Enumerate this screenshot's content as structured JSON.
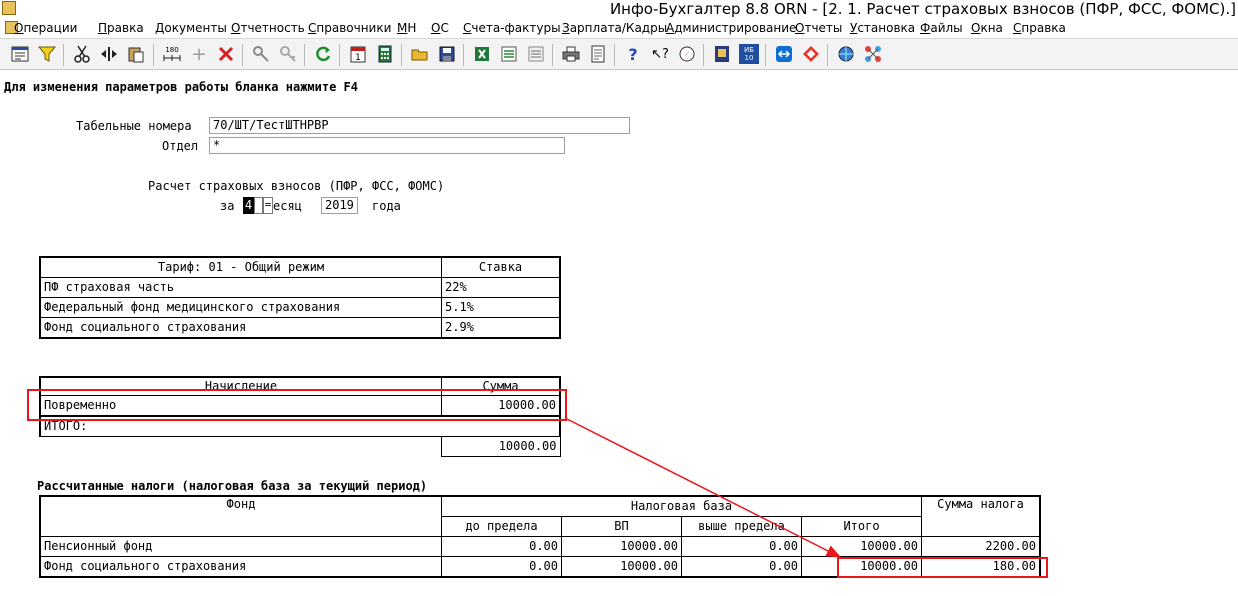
{
  "titlebar": {
    "title": "Инфо-Бухгалтер 8.8   ORN   - [2. 1. Расчет страховых взносов (ПФР, ФСС, ФОМС).]"
  },
  "menu": [
    {
      "label": "Операции",
      "mn": "О",
      "rest": "перации"
    },
    {
      "label": "Правка",
      "mn": "П",
      "rest": "равка"
    },
    {
      "label": "Документы",
      "mn": "Д",
      "rest": "окументы"
    },
    {
      "label": "Отчетность",
      "mn": "О",
      "rest": "тчетность"
    },
    {
      "label": "Справочники",
      "mn": "С",
      "rest": "правочники"
    },
    {
      "label": "МН",
      "mn": "М",
      "rest": "Н"
    },
    {
      "label": "ОС",
      "mn": "О",
      "rest": "С"
    },
    {
      "label": "Счета-фактуры",
      "mn": "С",
      "rest": "чета-фактуры"
    },
    {
      "label": "Зарплата/Кадры",
      "mn": "З",
      "rest": "арплата/Кадры"
    },
    {
      "label": "Администрирование",
      "mn": "А",
      "rest": "дминистрирование"
    },
    {
      "label": "Отчеты",
      "mn": "О",
      "rest": "тчеты"
    },
    {
      "label": "Установка",
      "mn": "У",
      "rest": "становка"
    },
    {
      "label": "Файлы",
      "mn": "Ф",
      "rest": "айлы"
    },
    {
      "label": "Окна",
      "mn": "О",
      "rest": "кна"
    },
    {
      "label": "Справка",
      "mn": "С",
      "rest": "правка"
    }
  ],
  "toolbar": {
    "icons": [
      "form-icon",
      "filter-icon",
      "cut-icon",
      "split-icon",
      "paste-icon",
      "ruler-icon",
      "add-icon",
      "delete-icon",
      "key-icon",
      "key-disabled-icon",
      "refresh-icon",
      "calendar-icon",
      "calculator-icon",
      "open-folder-icon",
      "save-icon",
      "excel-icon",
      "export-icon",
      "import-icon",
      "print-icon",
      "preview-icon",
      "help-icon",
      "whats-this-icon",
      "compass-icon",
      "book-icon",
      "ib10-icon",
      "teamviewer-icon",
      "anydesk-icon",
      "globe-icon",
      "network-icon"
    ],
    "calendar_digit": "1",
    "ib10_text": "ИБ\n10",
    "ruler_text": "180"
  },
  "hint": "Для изменения параметров работы бланка нажмите F4",
  "form": {
    "tab_label": "Табельные номера",
    "tab_value": "70/ШТ/ТестШТНРВР",
    "dept_label": "Отдел",
    "dept_value": "*",
    "calc_title": "Расчет страховых взносов (ПФР, ФСС, ФОМС)",
    "za": "за",
    "month_value": "4",
    "month_word": "есяц",
    "year_value": "2019",
    "year_word": "года"
  },
  "tariff": {
    "header": "Тариф: 01 - Общий режим",
    "rate_header": "Ставка",
    "rows": [
      {
        "name": "ПФ страховая часть",
        "rate": "22%"
      },
      {
        "name": "Федеральный фонд медицинского страхования",
        "rate": "5.1%"
      },
      {
        "name": "Фонд социального страхования",
        "rate": "2.9%"
      }
    ]
  },
  "accrual": {
    "header": "Начисление",
    "sum_header": "Сумма",
    "row_name": "Повременно",
    "row_sum": "10000.00",
    "total_label": "ИТОГО:",
    "total_sum": "10000.00"
  },
  "taxes": {
    "title": "Рассчитанные налоги (налоговая база за текущий период)",
    "col_fund": "Фонд",
    "col_base": "Налоговая база",
    "col_tax": "Сумма налога",
    "sub_limit": "до предела",
    "sub_vp": "ВП",
    "sub_over": "выше предела",
    "sub_total": "Итого",
    "rows": [
      {
        "fund": "Пенсионный фонд",
        "limit": "0.00",
        "vp": "10000.00",
        "over": "0.00",
        "total": "10000.00",
        "tax": "2200.00"
      },
      {
        "fund": "Фонд социального страхования",
        "limit": "0.00",
        "vp": "10000.00",
        "over": "0.00",
        "total": "10000.00",
        "tax": "180.00"
      }
    ]
  },
  "colors": {
    "annotation": "#e8181a",
    "toolbar_bg": "#f3f3f3"
  }
}
